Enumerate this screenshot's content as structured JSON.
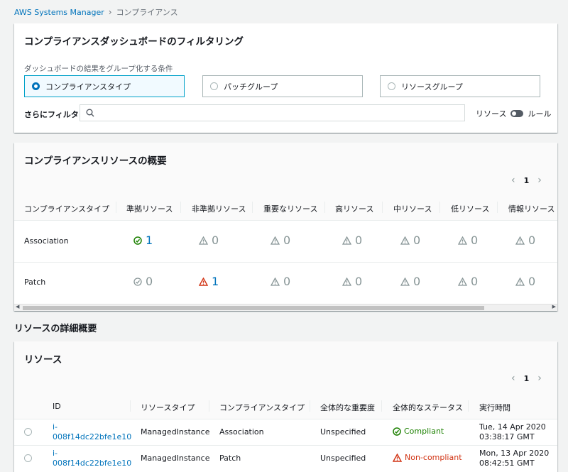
{
  "breadcrumb": {
    "root": "AWS Systems Manager",
    "current": "コンプライアンス"
  },
  "filter_panel": {
    "title": "コンプライアンスダッシュボードのフィルタリング",
    "group_label": "ダッシュボードの結果をグループ化する条件",
    "options": [
      {
        "label": "コンプライアンスタイプ",
        "selected": true
      },
      {
        "label": "パッチグループ",
        "selected": false
      },
      {
        "label": "リソースグループ",
        "selected": false
      }
    ],
    "more_filter_label": "さらにフィルタ",
    "search_placeholder": "",
    "toggle_left": "リソース",
    "toggle_right": "ルール"
  },
  "summary": {
    "title": "コンプライアンスリソースの概要",
    "page": "1",
    "columns": [
      "コンプライアンスタイプ",
      "準拠リソース",
      "非準拠リソース",
      "重要なリソース",
      "高リソース",
      "中リソース",
      "低リソース",
      "情報リソース"
    ],
    "rows": [
      {
        "type": "Association",
        "compliant": "1",
        "noncompliant": "0",
        "critical": "0",
        "high": "0",
        "medium": "0",
        "low": "0",
        "info": "0"
      },
      {
        "type": "Patch",
        "compliant": "0",
        "noncompliant": "1",
        "critical": "0",
        "high": "0",
        "medium": "0",
        "low": "0",
        "info": "0"
      }
    ]
  },
  "details_title": "リソースの詳細概要",
  "resources": {
    "title": "リソース",
    "page": "1",
    "columns": [
      "ID",
      "リソースタイプ",
      "コンプライアンスタイプ",
      "全体的な重要度",
      "全体的なステータス",
      "実行時間"
    ],
    "rows": [
      {
        "id_a": "i-",
        "id_b": "008f14dc22bfe1e10",
        "resource_type": "ManagedInstance",
        "compliance_type": "Association",
        "severity": "Unspecified",
        "status": "Compliant",
        "time_a": "Tue, 14 Apr 2020",
        "time_b": "03:38:17 GMT"
      },
      {
        "id_a": "i-",
        "id_b": "008f14dc22bfe1e10",
        "resource_type": "ManagedInstance",
        "compliance_type": "Patch",
        "severity": "Unspecified",
        "status": "Non-compliant",
        "time_a": "Mon, 13 Apr 2020",
        "time_b": "08:42:51 GMT"
      }
    ]
  },
  "colors": {
    "link": "#0073bb",
    "compliant": "#1d8102",
    "noncompliant": "#d13212",
    "muted": "#879596"
  }
}
